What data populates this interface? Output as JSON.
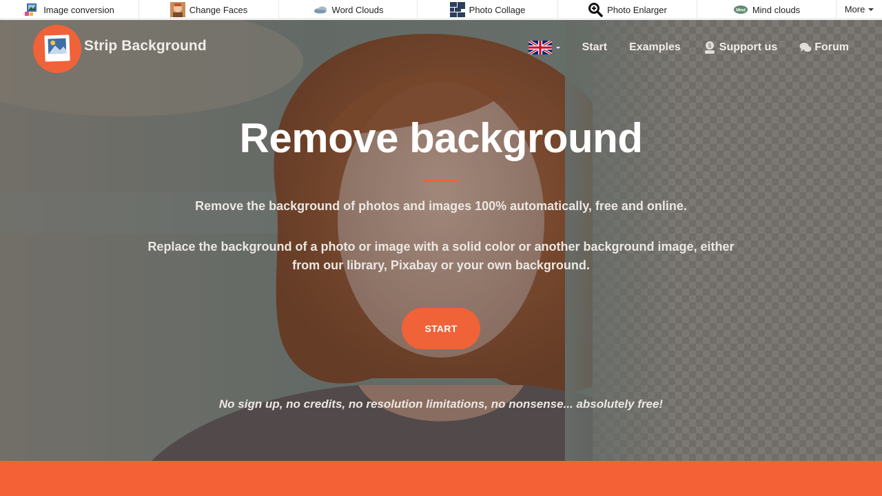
{
  "topbar": {
    "tools": [
      {
        "label": "Image conversion",
        "icon": "image-conversion-icon"
      },
      {
        "label": "Change Faces",
        "icon": "face-icon"
      },
      {
        "label": "Word Clouds",
        "icon": "cloud-icon"
      },
      {
        "label": "Photo Collage",
        "icon": "collage-icon"
      },
      {
        "label": "Photo Enlarger",
        "icon": "magnifier-icon"
      },
      {
        "label": "Mind clouds",
        "icon": "mind-cloud-icon",
        "badge": "Mind"
      }
    ],
    "more_label": "More"
  },
  "nav": {
    "brand": "Strip Background",
    "items": [
      {
        "label": "Start"
      },
      {
        "label": "Examples"
      },
      {
        "label": "Support us",
        "icon": "coin-user-icon",
        "coin": "$"
      },
      {
        "label": "Forum",
        "icon": "chat-bubbles-icon"
      }
    ],
    "language_icon": "uk-flag-icon"
  },
  "hero": {
    "title": "Remove background",
    "subtitle": "Remove the background of photos and images 100% automatically, free and online.",
    "description": "Replace the background of a photo or image with a solid color or another background image, either from our library, Pixabay or your own background.",
    "start_button": "START",
    "tagline": "No sign up, no credits, no resolution limitations, no nonsense... absolutely free!"
  },
  "colors": {
    "accent": "#f06238",
    "band": "#f46137",
    "text_light": "#ece7e2"
  }
}
